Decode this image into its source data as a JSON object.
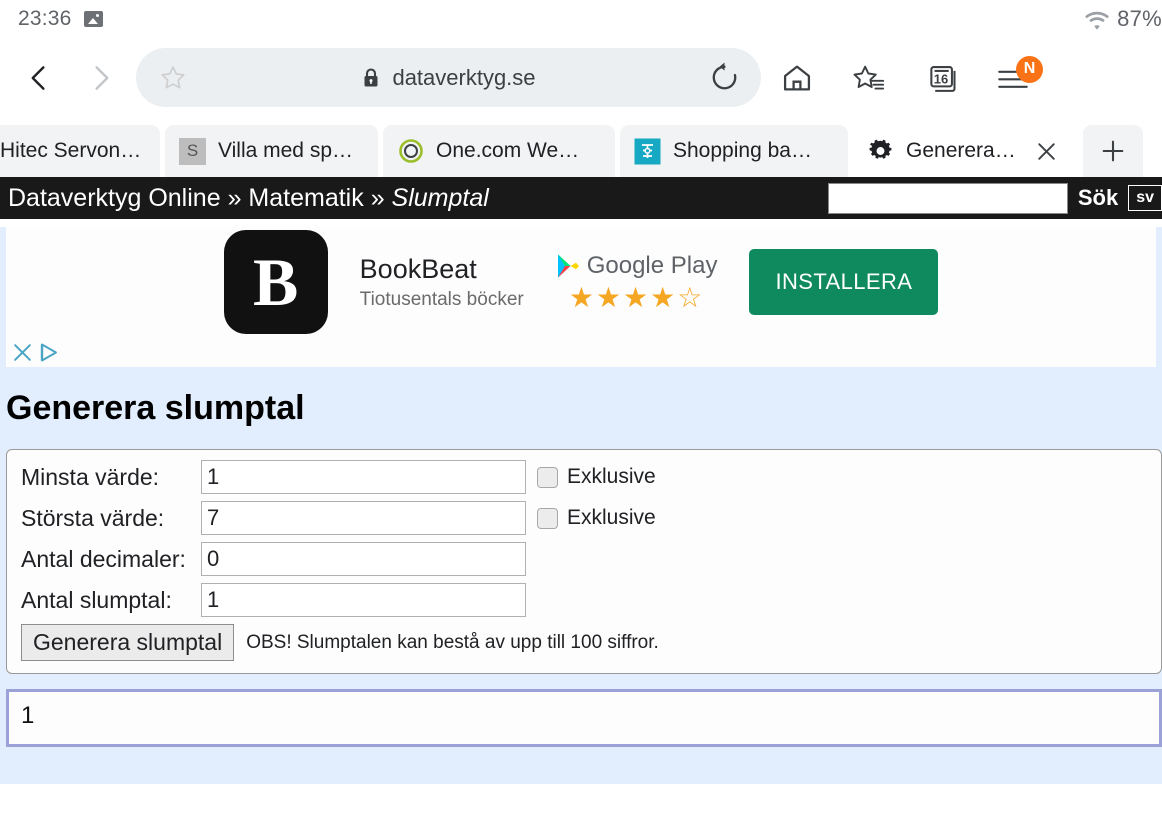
{
  "status_bar": {
    "clock": "23:36",
    "battery": "87%",
    "image_icon": "image-icon",
    "wifi_icon": "wifi-icon"
  },
  "browser": {
    "back_icon": "back-arrow-icon",
    "forward_icon": "forward-arrow-icon",
    "bookmark_star_icon": "star-icon",
    "lock_icon": "lock-icon",
    "url": "dataverktyg.se",
    "reload_icon": "reload-icon",
    "home_icon": "home-icon",
    "bookmarks_icon": "bookmarks-star-list-icon",
    "tabs_icon": "tab-switcher-icon",
    "tab_count": "16",
    "menu_icon": "hamburger-menu-icon",
    "menu_badge": "N"
  },
  "tabs": [
    {
      "title": "Hitec Servon…",
      "favicon": "none",
      "active": false
    },
    {
      "title": "Villa med sp…",
      "favicon": "letter-s",
      "active": false
    },
    {
      "title": "One.com We…",
      "favicon": "onecom-circle",
      "active": false
    },
    {
      "title": "Shopping ba…",
      "favicon": "cyan-square",
      "active": false
    },
    {
      "title": "Generera…",
      "favicon": "gear",
      "active": true
    }
  ],
  "new_tab_label": "+",
  "tab_close_icon": "close-icon",
  "site_header": {
    "breadcrumb_root": "Dataverktyg Online",
    "sep1": "»",
    "breadcrumb_section": "Matematik",
    "sep2": "»",
    "breadcrumb_current": "Slumptal",
    "search_value": "",
    "search_placeholder": "",
    "search_button": "Sök",
    "language": "sv"
  },
  "ad": {
    "logo_letter": "B",
    "title": "BookBeat",
    "subtitle": "Tiotusentals böcker",
    "store": "Google Play",
    "stars_filled": 4,
    "stars_total": 5,
    "cta": "INSTALLERA",
    "close_icon": "close-icon",
    "adchoices_icon": "adchoices-icon"
  },
  "main": {
    "title": "Generera slumptal",
    "fields": [
      {
        "label": "Minsta värde:",
        "value": "1",
        "checkbox_label": "Exklusive",
        "checked": false,
        "has_checkbox": true
      },
      {
        "label": "Största värde:",
        "value": "7",
        "checkbox_label": "Exklusive",
        "checked": false,
        "has_checkbox": true
      },
      {
        "label": "Antal decimaler:",
        "value": "0",
        "checkbox_label": "",
        "checked": false,
        "has_checkbox": false
      },
      {
        "label": "Antal slumptal:",
        "value": "1",
        "checkbox_label": "",
        "checked": false,
        "has_checkbox": false
      }
    ],
    "generate_button": "Generera slumptal",
    "note": "OBS! Slumptalen kan bestå av upp till 100 siffror.",
    "result": "1"
  },
  "colors": {
    "page_bg": "#e2edfd",
    "header_bg": "#191919",
    "cta_green": "#0f8a5f",
    "badge_orange": "#f97316",
    "result_border": "#9aa2d8",
    "star_gold": "#f5a623"
  }
}
